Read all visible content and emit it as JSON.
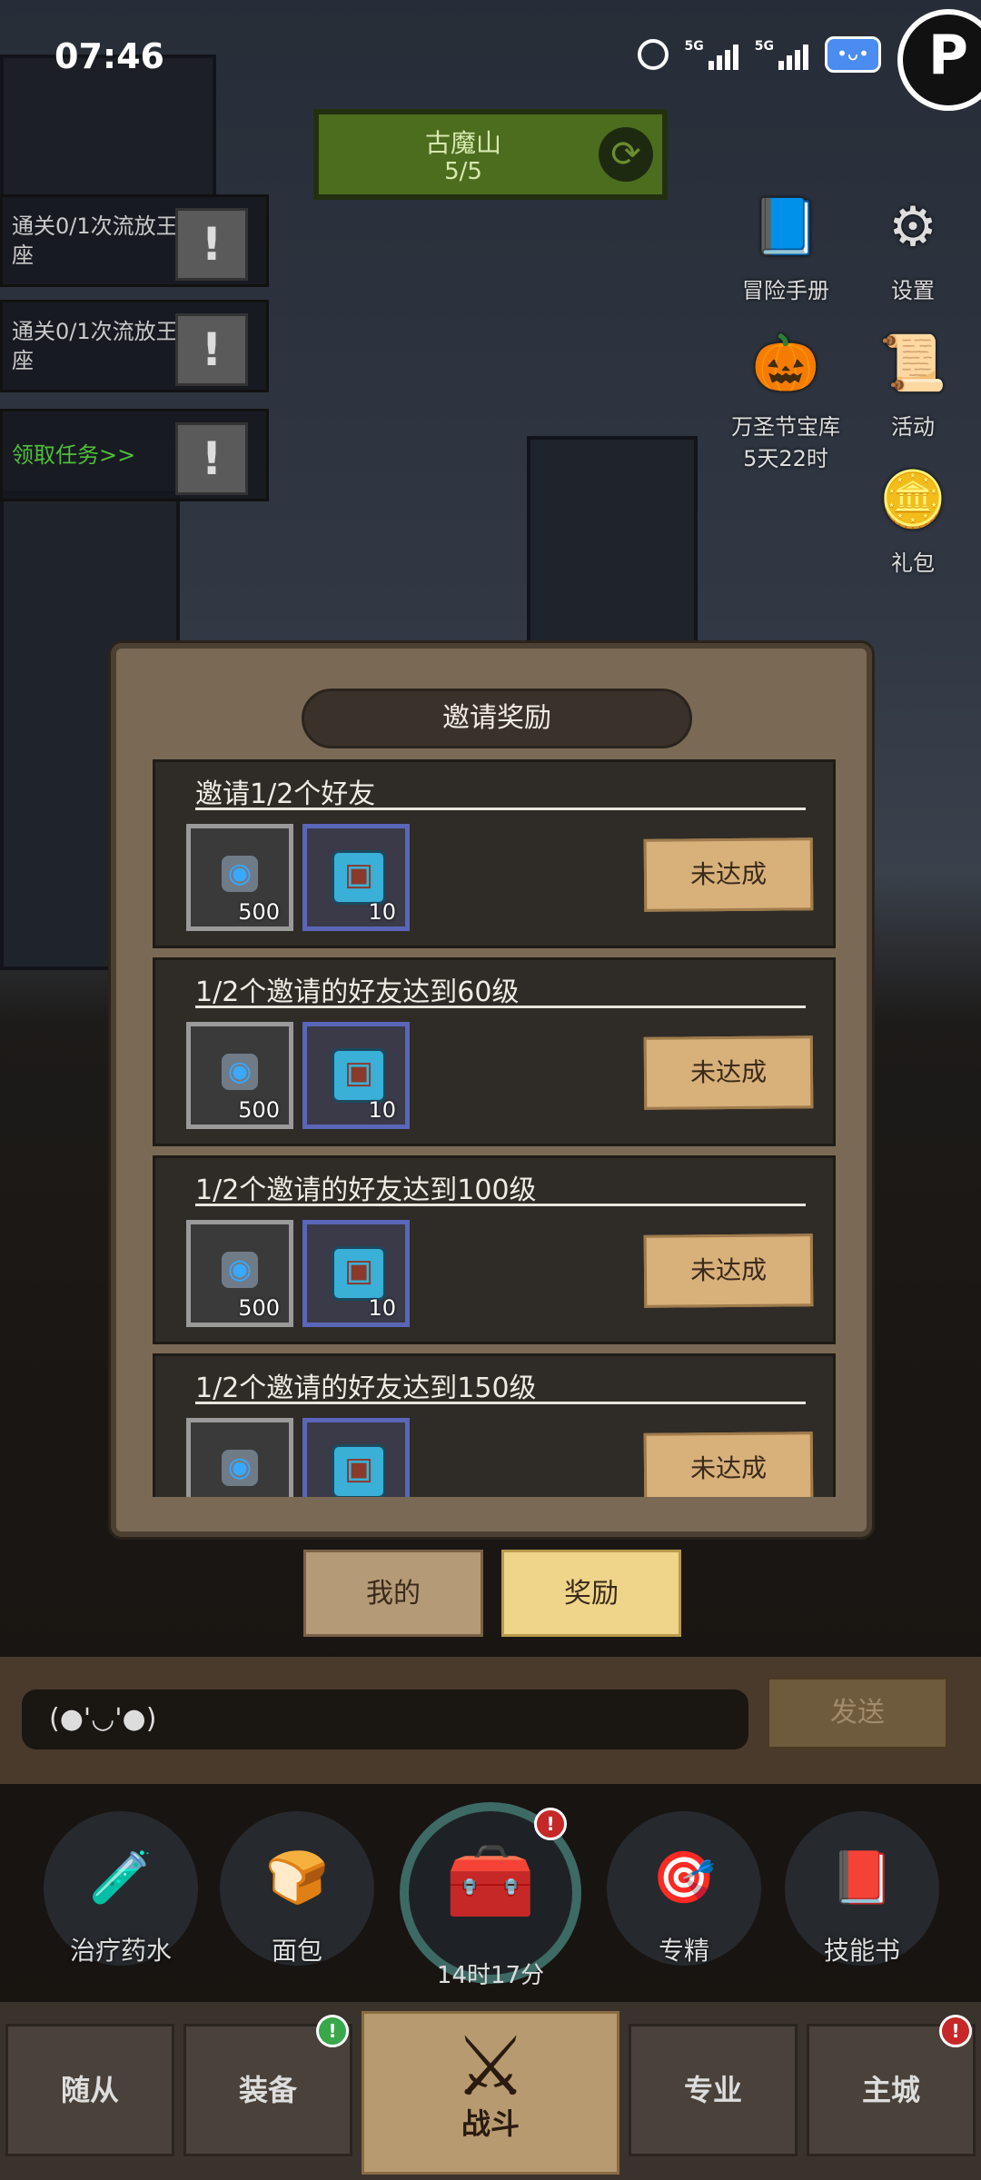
{
  "status_bar": {
    "time": "07:46",
    "net1": "5G",
    "net2": "5G",
    "assistant_glyph": "•ᴗ•",
    "corner_glyph": "P"
  },
  "map": {
    "name": "古魔山",
    "progress": "5/5"
  },
  "quests": [
    {
      "text": "通关0/1次流放王座",
      "mark": "!"
    },
    {
      "text": "通关0/1次流放王座",
      "mark": "!"
    },
    {
      "text": "领取任务>>",
      "mark": "!"
    }
  ],
  "right_menu": [
    {
      "label": "冒险手册",
      "icon": "book-icon"
    },
    {
      "label": "设置",
      "icon": "gear-icon"
    },
    {
      "label": "万圣节宝库",
      "sub": "5天22时",
      "icon": "pumpkin-icon"
    },
    {
      "label": "活动",
      "icon": "scroll-icon"
    },
    {
      "label": "礼包",
      "icon": "coin-icon"
    }
  ],
  "modal": {
    "title": "邀请奖励",
    "rewards": [
      {
        "title": "邀请1/2个好友",
        "item1_qty": "500",
        "item2_qty": "10",
        "button": "未达成"
      },
      {
        "title": "1/2个邀请的好友达到60级",
        "item1_qty": "500",
        "item2_qty": "10",
        "button": "未达成"
      },
      {
        "title": "1/2个邀请的好友达到100级",
        "item1_qty": "500",
        "item2_qty": "10",
        "button": "未达成"
      },
      {
        "title": "1/2个邀请的好友达到150级",
        "item1_qty": "",
        "item2_qty": "",
        "button": "未达成"
      }
    ]
  },
  "tabs": {
    "mine": "我的",
    "reward": "奖励"
  },
  "chat": {
    "input_value": "(●'◡'●)",
    "send": "发送"
  },
  "quick_items": [
    {
      "label": "治疗药水",
      "icon": "potion-icon"
    },
    {
      "label": "面包",
      "icon": "bread-icon"
    },
    {
      "label": "专精",
      "icon": "target-icon"
    },
    {
      "label": "技能书",
      "icon": "skillbook-icon"
    }
  ],
  "chest": {
    "timer": "14时17分",
    "badge": "!"
  },
  "badges": {
    "equip": "!",
    "city": "!"
  },
  "nav": {
    "followers": "随从",
    "equipment": "装备",
    "battle": "战斗",
    "specialty": "专业",
    "city": "主城"
  },
  "colors": {
    "accent": "#efd58a",
    "quest_green": "#4fbf3a",
    "alert_red": "#c62828"
  }
}
